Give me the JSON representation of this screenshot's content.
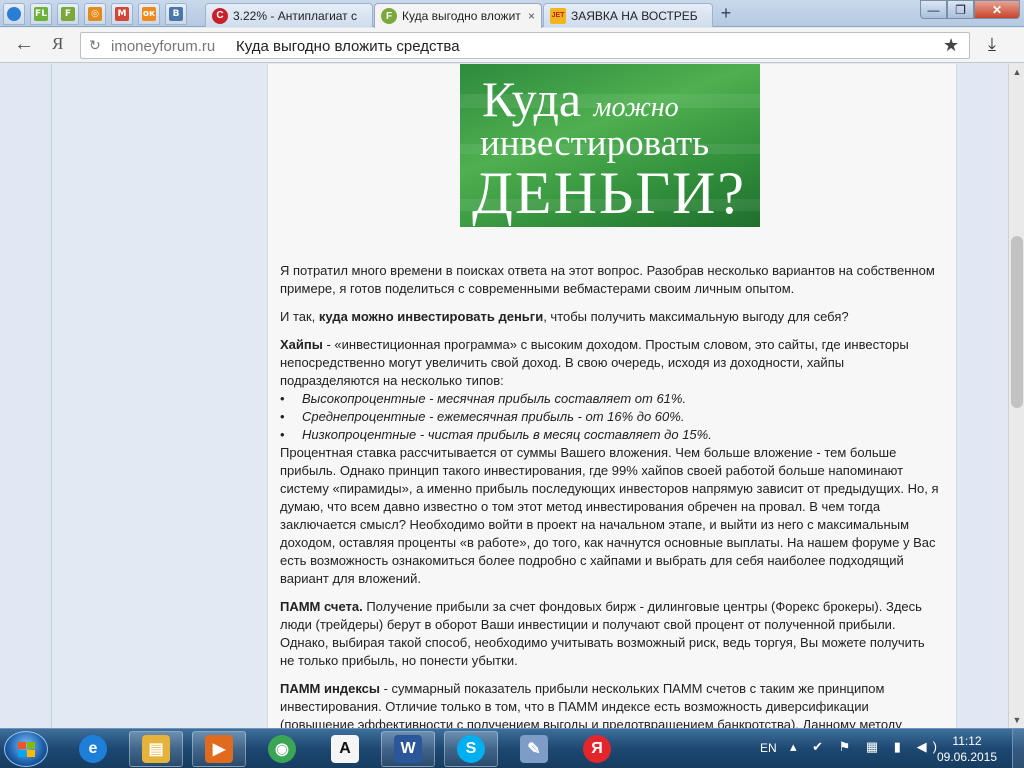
{
  "browser": {
    "pinned_tabs": [
      {
        "icon": "globe-icon",
        "glyph": "",
        "color": "#2a7fd4"
      },
      {
        "icon": "fl-icon",
        "glyph": "FL",
        "color": "#6bb13a"
      },
      {
        "icon": "forum-f-icon",
        "glyph": "F",
        "color": "#7aa83a"
      },
      {
        "icon": "target-icon",
        "glyph": "◎",
        "color": "#e58b1c"
      },
      {
        "icon": "gmail-icon",
        "glyph": "M",
        "color": "#d14836"
      },
      {
        "icon": "odnoklassniki-icon",
        "glyph": "ок",
        "color": "#f08a1c"
      },
      {
        "icon": "vk-icon",
        "glyph": "В",
        "color": "#4a76a8"
      }
    ],
    "tabs": [
      {
        "title": "3.22% - Антиплагиат с",
        "icon": "copyright-icon",
        "color": "#c8202a",
        "glyph": "C"
      },
      {
        "title": "Куда выгодно вложит",
        "icon": "forum-f-icon",
        "color": "#7aa83a",
        "glyph": "F",
        "active": true
      },
      {
        "title": "ЗАЯВКА НА ВОСТРЕБ",
        "icon": "jet-icon",
        "color": "#f2b51e",
        "glyph": "JET"
      }
    ],
    "close_glyph": "×",
    "new_tab_glyph": "+",
    "window": {
      "minimize": "—",
      "maximize": "❐",
      "close": "✕"
    },
    "address": {
      "back_glyph": "←",
      "yandex_glyph": "Я",
      "reload_glyph": "↻",
      "domain": "imoneyforum.ru",
      "page_title": "Куда выгодно вложить средства",
      "star_glyph": "★",
      "download_glyph": "⤓"
    }
  },
  "banner": {
    "line1_big": "Куда",
    "line1_small": "можно",
    "line2": "инвестировать",
    "line3": "ДЕНЬГИ?"
  },
  "article": {
    "intro": "Я потратил много времени в поисках ответа на этот вопрос. Разобрав несколько вариантов на собственном примере, я готов поделиться с современными вебмастерами своим личным опытом.",
    "q_before": "И так, ",
    "q_bold": "куда можно инвестировать деньги",
    "q_after": ", чтобы получить максимальную выгоду для себя?",
    "hyips_bold": "Хайпы",
    "hyips_text": " - «инвестиционная программа» с высоким доходом. Простым словом, это сайты, где инвесторы непосредственно могут увеличить свой доход. В свою очередь, исходя из доходности, хайпы подразделяются на несколько типов:",
    "hyip_types": [
      "Высокопроцентные - месячная прибыль составляет от 61%.",
      "Среднепроцентные - ежемесячная прибыль - от 16% до 60%.",
      "Низкопроцентные - чистая прибыль в месяц составляет до 15%."
    ],
    "hyips_more": "Процентная ставка рассчитывается от суммы Вашего вложения. Чем больше вложение - тем больше прибыль. Однако принцип такого инвестирования, где 99% хайпов своей работой больше напоминают систему «пирамиды», а именно прибыль последующих инвесторов напрямую зависит от предыдущих. Но, я думаю, что всем давно известно о том этот метод инвестирования обречен на провал. В чем тогда заключается смысл? Необходимо войти в проект на начальном этапе, и выйти из него с максимальным доходом, оставляя проценты «в работе», до того, как начнутся основные выплаты. На нашем форуме у Вас есть возможность ознакомиться более подробно с хайпами и выбрать для себя наиболее подходящий вариант для вложений.",
    "pamm_bold": "ПАММ счета.",
    "pamm_text": " Получение прибыли за счет фондовых бирж - дилинговые центры (Форекс брокеры). Здесь люди (трейдеры) берут в оборот Ваши инвестиции и получают свой процент от полученной прибыли. Однако, выбирая такой способ, необходимо учитывать возможный риск, ведь торгуя, Вы можете получить не только прибыль, но понести убытки.",
    "pammi_bold": "ПАММ индексы",
    "pammi_text": " - суммарный показатель прибыли нескольких ПАММ счетов с таким же принципом инвестирования. Отличие только в том, что в ПАММ индексе есть возможность диверсификации (повышение эффективности с получением выгоды и предотвращением банкротства). Данному методу"
  },
  "scrollbar": {
    "up": "▲",
    "down": "▼"
  },
  "taskbar": {
    "apps": [
      {
        "name": "ie-icon",
        "glyph": "e",
        "color": "#1e7fd8"
      },
      {
        "name": "explorer-icon",
        "glyph": "▤",
        "color": "#e5b33c",
        "open": true
      },
      {
        "name": "media-player-icon",
        "glyph": "▶",
        "color": "#e06b1f",
        "open": true
      },
      {
        "name": "chrome-icon",
        "glyph": "◉",
        "color": "#3aa655"
      },
      {
        "name": "font-app-icon",
        "glyph": "A",
        "color": "#f5f5f5"
      },
      {
        "name": "word-icon",
        "glyph": "W",
        "color": "#2b579a",
        "open": true
      },
      {
        "name": "skype-icon",
        "glyph": "S",
        "color": "#00aff0",
        "open": true
      },
      {
        "name": "paint-icon",
        "glyph": "✎",
        "color": "#7d9dc7"
      },
      {
        "name": "yandex-browser-icon",
        "glyph": "Я",
        "color": "#e3262b"
      }
    ],
    "lang": "EN",
    "time": "11:12",
    "date": "09.06.2015"
  }
}
